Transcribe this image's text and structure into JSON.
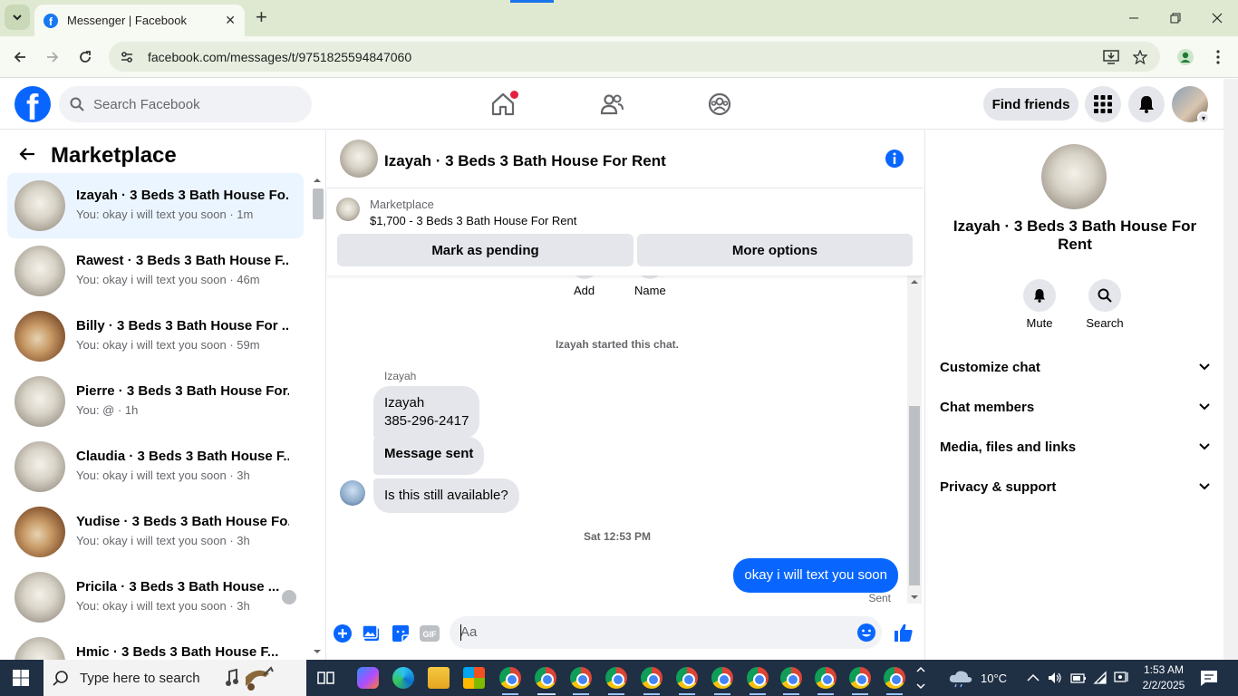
{
  "browser": {
    "tab_title": "Messenger | Facebook",
    "url": "facebook.com/messages/t/9751825594847060",
    "colors": {
      "tabbar": "#dfe9d2",
      "toolbar": "#f7f9f3"
    }
  },
  "header": {
    "search_placeholder": "Search Facebook",
    "find_friends": "Find friends",
    "icons": [
      "home-icon",
      "friends-icon",
      "groups-icon",
      "menu-grid-icon",
      "notifications-bell-icon"
    ],
    "brand_color": "#0866ff"
  },
  "left": {
    "title": "Marketplace",
    "conversations": [
      {
        "name": "Izayah · 3 Beds 3 Bath House Fo...",
        "last": "You: okay i will text you soon · 1m",
        "active": true
      },
      {
        "name": "Rawest · 3 Beds 3 Bath House F...",
        "last": "You: okay i will text you soon · 46m"
      },
      {
        "name": "Billy · 3 Beds 3 Bath House For ...",
        "last": "You: okay i will text you soon · 59m"
      },
      {
        "name": "Pierre · 3 Beds 3 Bath House For...",
        "last": "You: @ · 1h"
      },
      {
        "name": "Claudia · 3 Beds 3 Bath House F...",
        "last": "You: okay i will text you soon · 3h"
      },
      {
        "name": "Yudise · 3 Beds 3 Bath House Fo...",
        "last": "You: okay i will text you soon · 3h"
      },
      {
        "name": "Pricila · 3 Beds 3 Bath House ...",
        "last": "You: okay i will text you soon · 3h"
      },
      {
        "name": "Hmic · 3 Beds 3 Bath House F...",
        "last": ""
      }
    ]
  },
  "chat": {
    "title": "Izayah · 3 Beds 3 Bath House For Rent",
    "marketplace_label": "Marketplace",
    "listing": "$1,700 - 3 Beds 3 Bath House For Rent",
    "mark_pending": "Mark as pending",
    "more_options": "More options",
    "top_actions": [
      "Add",
      "Name"
    ],
    "system_msg": "Izayah started this chat.",
    "sender": "Izayah",
    "bubble1_line1": "Izayah",
    "bubble1_line2": "385-296-2417",
    "bubble2": "Message sent",
    "bubble3": "Is this still available?",
    "timestamp": "Sat 12:53 PM",
    "out_msg": "okay i will text you soon",
    "status": "Sent",
    "composer_placeholder": "Aa"
  },
  "right": {
    "name": "Izayah · 3 Beds 3 Bath House For Rent",
    "mute": "Mute",
    "search": "Search",
    "sections": [
      "Customize chat",
      "Chat members",
      "Media, files and links",
      "Privacy & support"
    ]
  },
  "taskbar": {
    "search_placeholder": "Type here to search",
    "weather": "10°C",
    "time": "1:53 AM",
    "date": "2/2/2025"
  }
}
